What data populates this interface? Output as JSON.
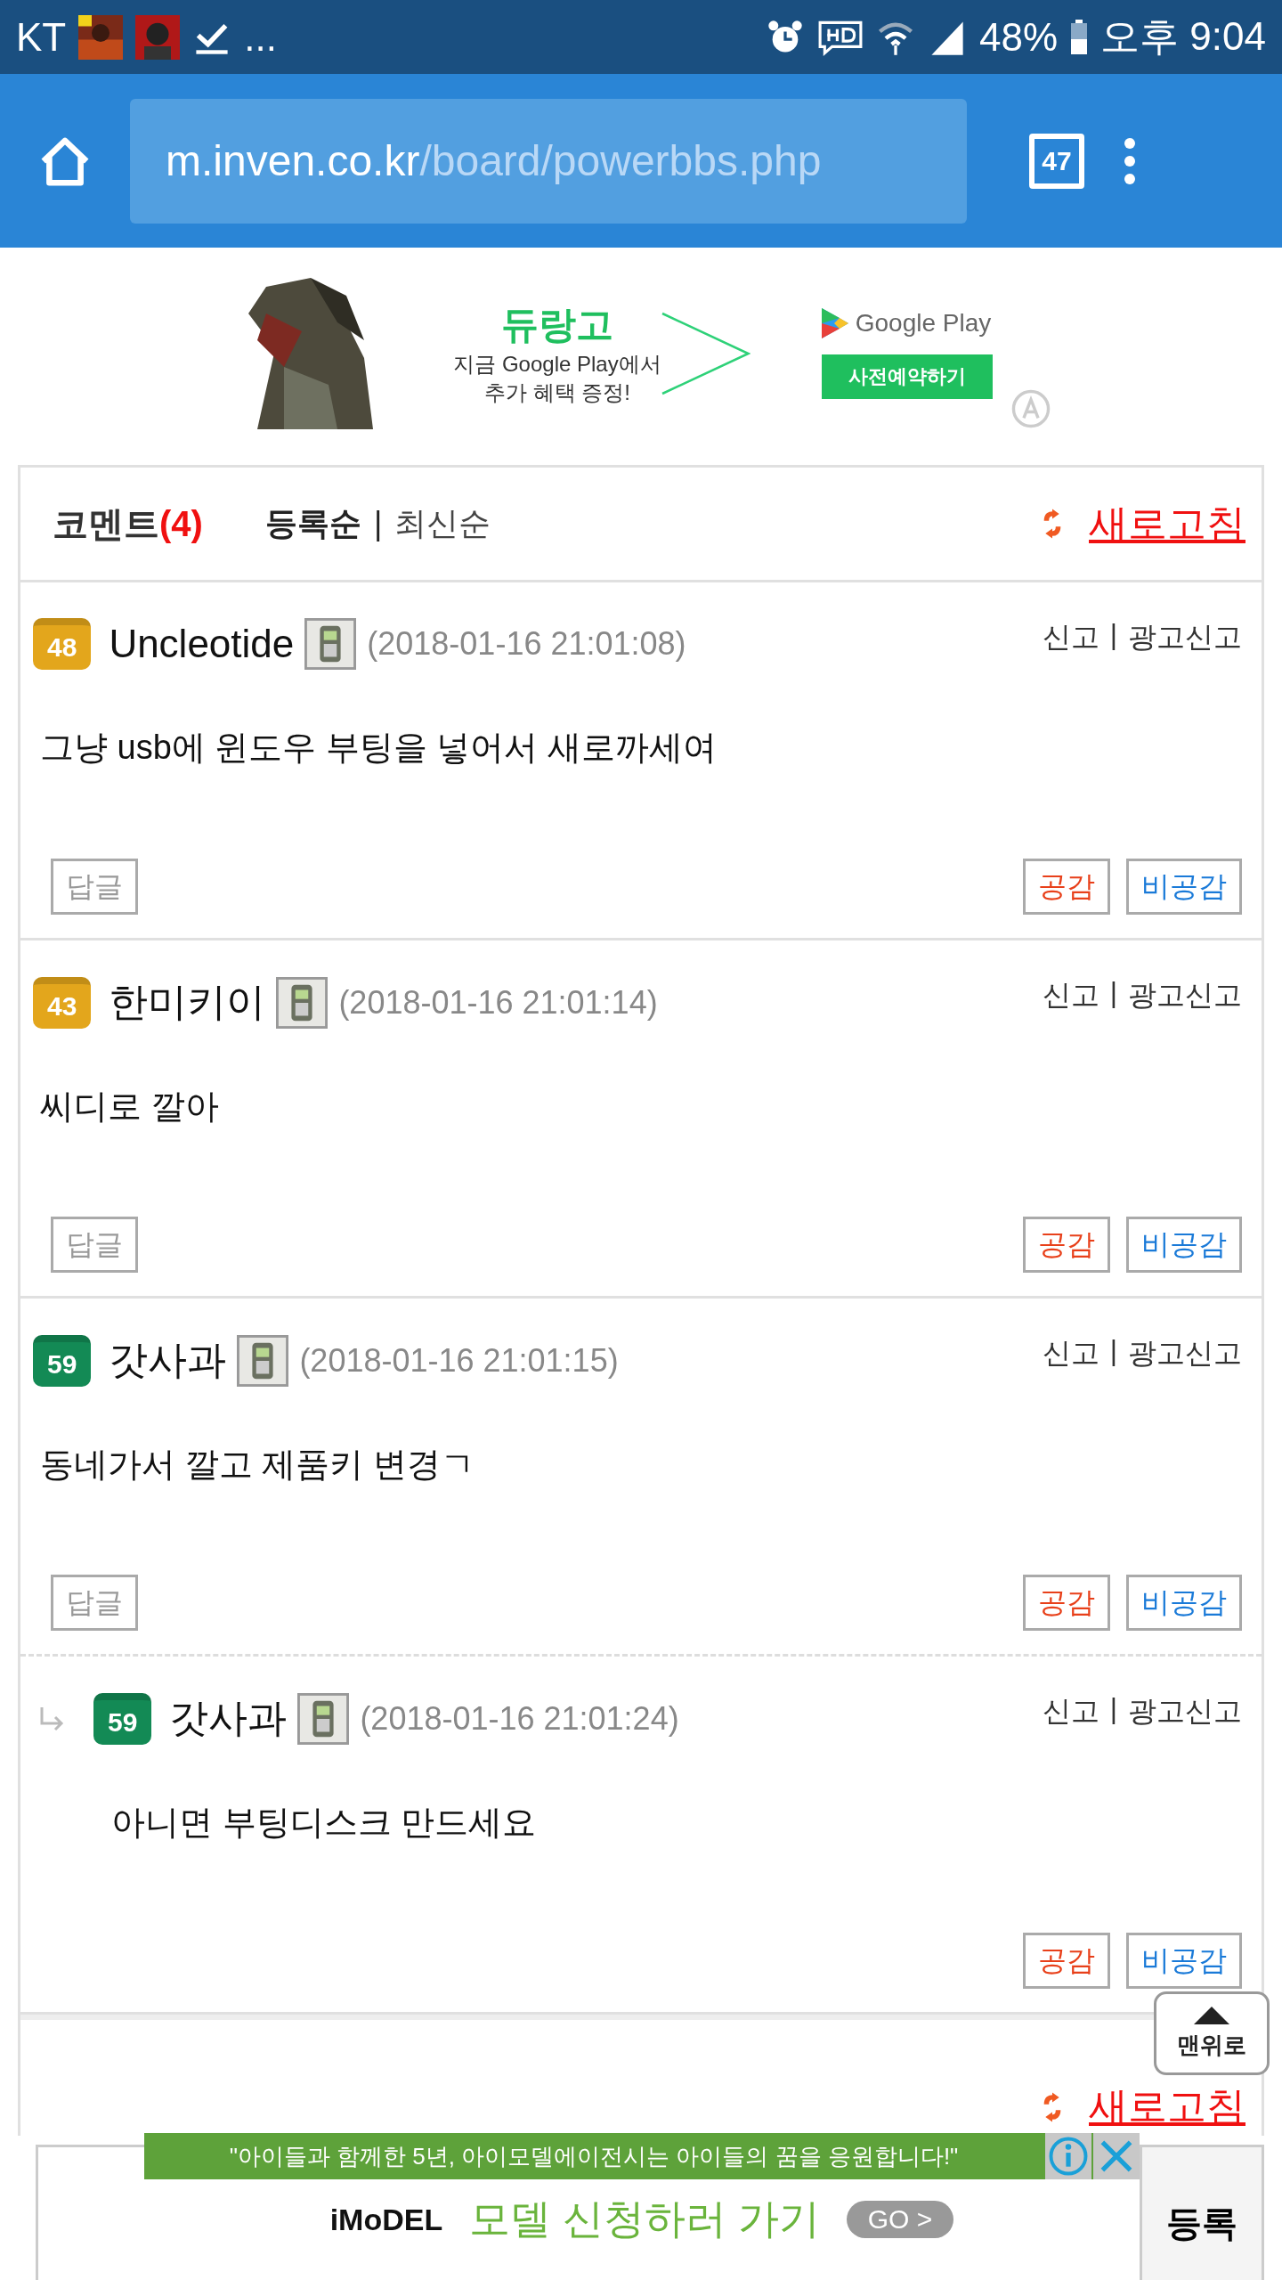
{
  "status_bar": {
    "carrier": "KT",
    "more": "...",
    "battery": "48%",
    "time": "오후 9:04"
  },
  "browser": {
    "url_host": "m.inven.co.kr",
    "url_path": "/board/powerbbs.php",
    "tab_count": "47"
  },
  "ad_banner": {
    "title": "듀랑고",
    "line_1": "지금 Google Play에서",
    "line_2": "추가 혜택 증정!",
    "store": "Google Play",
    "button": "사전예약하기"
  },
  "comments": {
    "title": "코멘트",
    "count": "(4)",
    "sort": [
      {
        "label": "등록순",
        "selected": true
      },
      {
        "label": "최신순",
        "selected": false
      }
    ],
    "sort_separator": "|",
    "refresh": "새로고침",
    "items": [
      {
        "kind": "comment",
        "level": {
          "text": "48",
          "color": "#e3a61c"
        },
        "author": "Uncleotide",
        "date": "(2018-01-16 21:01:08)",
        "report": "신고",
        "separator": "|",
        "ad_report": "광고신고",
        "body": "그냥 usb에 윈도우 부팅을 넣어서 새로까세여",
        "reply": "답글",
        "like": "공감",
        "dislike": "비공감"
      },
      {
        "kind": "comment",
        "level": {
          "text": "43",
          "color": "#e3a61c"
        },
        "author": "한미키이",
        "date": "(2018-01-16 21:01:14)",
        "report": "신고",
        "separator": "|",
        "ad_report": "광고신고",
        "body": "씨디로 깔아",
        "reply": "답글",
        "like": "공감",
        "dislike": "비공감"
      },
      {
        "kind": "comment",
        "level": {
          "text": "59",
          "color": "#138a55"
        },
        "author": "갓사과",
        "date": "(2018-01-16 21:01:15)",
        "report": "신고",
        "separator": "|",
        "ad_report": "광고신고",
        "body": "동네가서 깔고 제품키 변경ㄱ",
        "reply": "답글",
        "like": "공감",
        "dislike": "비공감"
      },
      {
        "kind": "reply",
        "level": {
          "text": "59",
          "color": "#138a55"
        },
        "author": "갓사과",
        "date": "(2018-01-16 21:01:24)",
        "report": "신고",
        "separator": "|",
        "ad_report": "광고신고",
        "body": "아니면 부팅디스크 만드세요",
        "like": "공감",
        "dislike": "비공감"
      }
    ]
  },
  "bottom": {
    "refresh": "새로고침",
    "submit": "등록"
  },
  "top_button": "맨위로",
  "overlay_ad": {
    "banner": "\"아이들과 함께한 5년, 아이모델에이전시는 아이들의 꿈을 응원합니다!\"",
    "brand": "iMoDEL",
    "cta": "모델 신청하러 가기",
    "go": "GO >"
  }
}
